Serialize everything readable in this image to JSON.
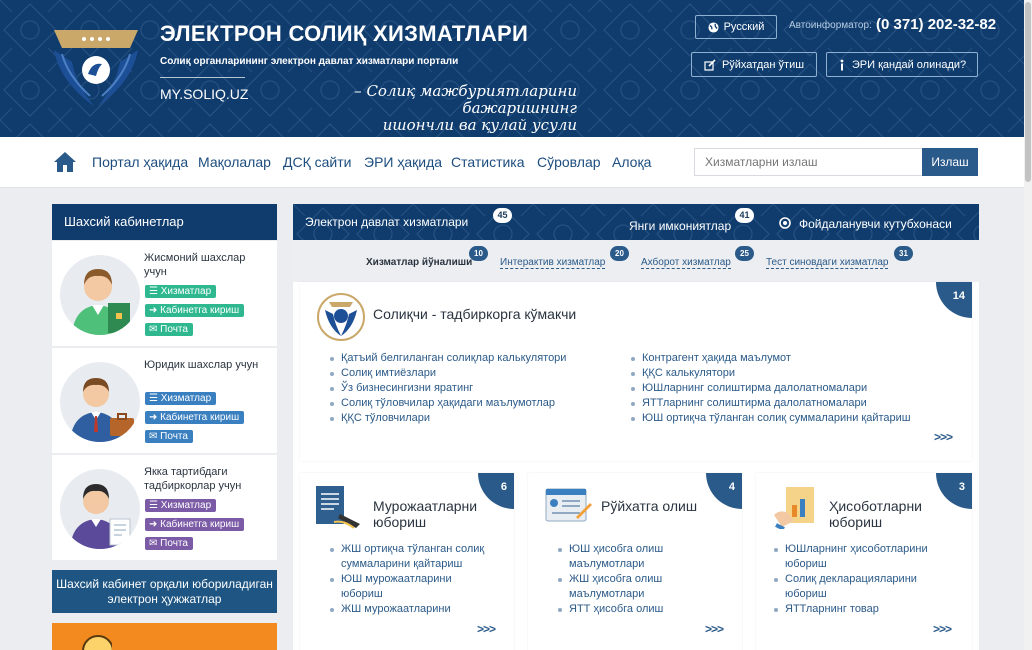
{
  "header": {
    "title": "ЭЛЕКТРОН СОЛИҚ ХИЗМАТЛАРИ",
    "subtitle": "Солиқ органларининг электрон давлат хизматлари портали",
    "site": "MY.SOLIQ.UZ",
    "slogan_line1": "– Солиқ мажбуриятларини бажаришнинг",
    "slogan_line2": "ишончли ва қулай усули",
    "language": "Русский",
    "autoinformer_label": "Автоинформатор:",
    "phone": "(0 371) 202-32-82",
    "register_button": "Рўйхатдан ўтиш",
    "eri_button": "ЭРИ қандай олинади?",
    "icons": {
      "language": "globe-icon",
      "register": "edit-icon",
      "eri": "info-icon"
    }
  },
  "nav": {
    "items": [
      "Портал ҳақида",
      "Мақолалар",
      "ДСҚ сайти",
      "ЭРИ ҳақида",
      "Статистика",
      "Сўровлар",
      "Алоқа"
    ],
    "search_placeholder": "Хизматларни излаш",
    "search_button": "Излаш"
  },
  "left": {
    "header": "Шахсий кабинетлар",
    "cards": [
      {
        "title": "Жисмоний шахслар учун",
        "pills": [
          "Хизматлар",
          "Кабинетга кириш",
          "Почта"
        ],
        "color": "#2fb890"
      },
      {
        "title": "Юридик шахслар учун",
        "pills": [
          "Хизматлар",
          "Кабинетга кириш",
          "Почта"
        ],
        "color": "#3a7fbf"
      },
      {
        "title": "Якка тартибдаги тадбиркорлар учун",
        "pills": [
          "Хизматлар",
          "Кабинетга кириш",
          "Почта"
        ],
        "color": "#7b5aa6"
      }
    ],
    "docs_box": "Шахсий кабинет орқали юбориладиган электрон ҳужжатлар"
  },
  "right": {
    "header": {
      "title": "Электрон давлат хизматлари",
      "title_count": "45",
      "new": "Янги имкониятлар",
      "new_count": "41",
      "library": "Фойдаланувчи кутубхонаси"
    },
    "tabs": [
      {
        "label": "Хизматлар йўналиши",
        "count": "10"
      },
      {
        "label": "Интерактив хизматлар",
        "count": "20"
      },
      {
        "label": "Ахборот хизматлар",
        "count": "25"
      },
      {
        "label": "Тест синовдаги хизматлар",
        "count": "31"
      }
    ],
    "main_box": {
      "title": "Солиқчи - тадбиркорга кўмакчи",
      "count": "14",
      "left_links": [
        "Қатъий белгиланган солиқлар калькулятори",
        "Солиқ имтиёзлари",
        "Ўз бизнесингизни яратинг",
        "Солиқ тўловчилар ҳақидаги маълумотлар",
        "ҚҚС тўловчилари"
      ],
      "right_links": [
        "Контрагент ҳақида маълумот",
        "ҚҚС калькулятори",
        "ЮШларнинг солиштирма далолатномалари",
        "ЯТТларнинг солиштирма далолатномалари",
        "ЮШ ортиқча тўланган солиқ суммаларини қайтариш"
      ],
      "more": ">>>"
    },
    "boxes": [
      {
        "title1": "Мурожаатларни",
        "title2": "юбориш",
        "count": "6",
        "links": [
          "ЖШ ортиқча тўланган солиқ",
          "суммаларини қайтариш",
          "ЮШ мурожаатларини",
          "юбориш",
          "ЖШ мурожаатларини"
        ],
        "more": ">>>"
      },
      {
        "title1": "Рўйхатга олиш",
        "title2": "",
        "count": "4",
        "links": [
          "ЮШ ҳисобга олиш",
          "маълумотлари",
          "ЖШ ҳисобга олиш",
          "маълумотлари",
          "ЯТТ ҳисобга олиш"
        ],
        "more": ">>>"
      },
      {
        "title1": "Ҳисоботларни",
        "title2": "юбориш",
        "count": "3",
        "links": [
          "ЮШларнинг ҳисоботларини",
          "юбориш",
          "Солиқ декларацияларини",
          "юбориш",
          "ЯТТларнинг товар"
        ],
        "more": ">>>"
      }
    ]
  }
}
